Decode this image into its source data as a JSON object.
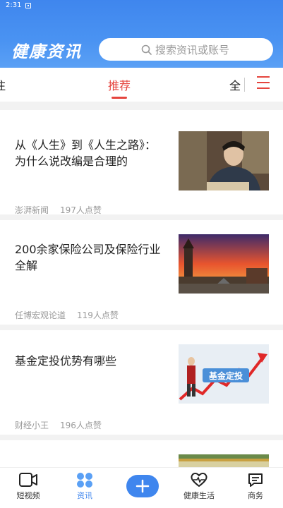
{
  "status_bar": {
    "time": "2:31"
  },
  "header": {
    "brand": "健康资讯",
    "search_placeholder": "搜索资讯或账号"
  },
  "tabs": {
    "left_partial": "注",
    "active": "推荐",
    "right_partial": "全"
  },
  "articles": [
    {
      "title": "从《人生》到《人生之路》：为什么说改编是合理的",
      "source": "澎湃新闻",
      "likes": "197人点赞"
    },
    {
      "title": "200余家保险公司及保险行业全解",
      "source": "任博宏观论道",
      "likes": "119人点赞"
    },
    {
      "title": "基金定投优势有哪些",
      "source": "财经小王",
      "likes": "196人点赞",
      "image_text": "基金定投"
    }
  ],
  "bottom_nav": {
    "short_video": "短视频",
    "news": "资讯",
    "health_life": "健康生活",
    "business": "商务"
  },
  "colors": {
    "accent": "#3f86ee",
    "active_tab": "#e5453e"
  }
}
